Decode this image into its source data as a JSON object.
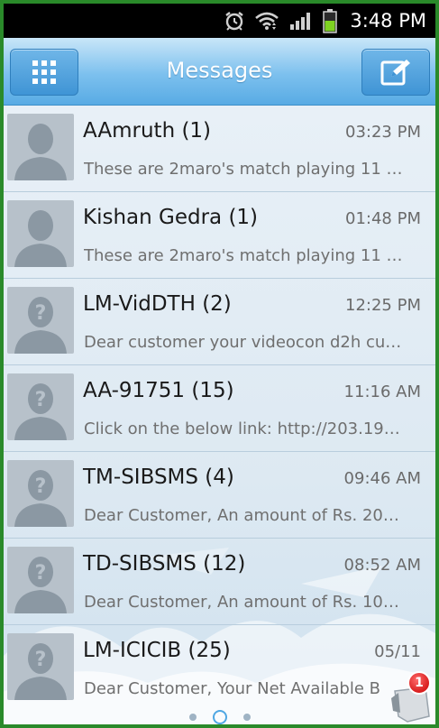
{
  "status_bar": {
    "time": "3:48 PM",
    "icons": [
      "alarm-icon",
      "wifi-icon",
      "signal-icon",
      "battery-icon"
    ]
  },
  "app_bar": {
    "title": "Messages",
    "left_icon": "grid-menu-icon",
    "right_icon": "compose-icon"
  },
  "colors": {
    "accent": "#4fa7e3",
    "frame_border": "#2a8a2a",
    "badge": "#d81d1d"
  },
  "conversations": [
    {
      "name": "AAmruth (1)",
      "time": "03:23 PM",
      "preview": "These are 2maro's match playing 11 …",
      "avatar": "person-silhouette-icon"
    },
    {
      "name": "Kishan Gedra (1)",
      "time": "01:48 PM",
      "preview": "These are 2maro's match playing 11 …",
      "avatar": "person-silhouette-icon"
    },
    {
      "name": "LM-VidDTH (2)",
      "time": "12:25 PM",
      "preview": "Dear customer your videocon d2h cu…",
      "avatar": "unknown-contact-icon"
    },
    {
      "name": "AA-91751 (15)",
      "time": "11:16 AM",
      "preview": "Click on the below link: http://203.19…",
      "avatar": "unknown-contact-icon"
    },
    {
      "name": "TM-SIBSMS (4)",
      "time": "09:46 AM",
      "preview": "Dear Customer, An amount of Rs. 20…",
      "avatar": "unknown-contact-icon"
    },
    {
      "name": "TD-SIBSMS (12)",
      "time": "08:52 AM",
      "preview": "Dear Customer, An amount of Rs. 10…",
      "avatar": "unknown-contact-icon"
    },
    {
      "name": "LM-ICICIB (25)",
      "time": "05/11",
      "preview": "Dear Customer, Your Net Available B",
      "avatar": "unknown-contact-icon"
    }
  ],
  "pager": {
    "count": 3,
    "active": 1
  },
  "floating_widget": {
    "badge_count": "1"
  }
}
